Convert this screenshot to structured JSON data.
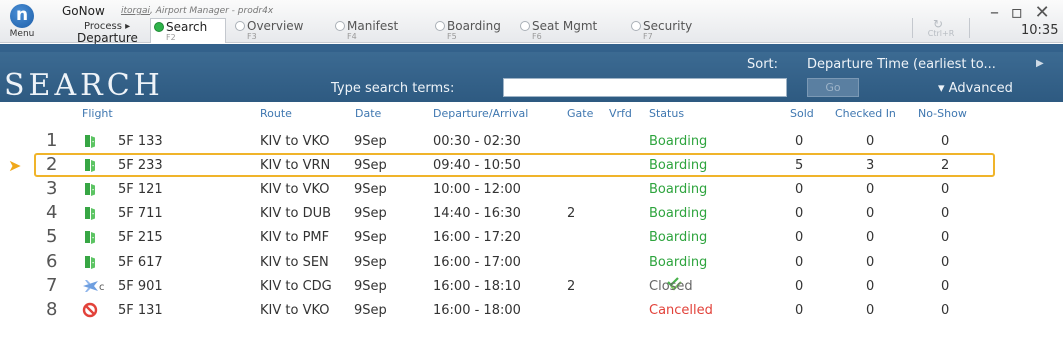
{
  "titlebar": {
    "menu_glyph": "n",
    "menu_label": "Menu",
    "app_name": "GoNow",
    "user": "itorgai",
    "role_env": ", Airport Manager - prodr4x",
    "process_label": "Process ▸",
    "departure_label": "Departure",
    "steps": [
      {
        "name": "Search",
        "key": "F2",
        "active": true
      },
      {
        "name": "Overview",
        "key": "F3",
        "active": false
      },
      {
        "name": "Manifest",
        "key": "F4",
        "active": false
      },
      {
        "name": "Boarding",
        "key": "F5",
        "active": false
      },
      {
        "name": "Seat Mgmt",
        "key": "F6",
        "active": false
      },
      {
        "name": "Security",
        "key": "F7",
        "active": false
      }
    ],
    "refresh_icon": "↻",
    "refresh_key": "Ctrl+R",
    "window_controls": "– ▫ ✕",
    "clock": "10:35"
  },
  "search": {
    "title": "SEARCH",
    "type_label": "Type search terms:",
    "input_value": "",
    "go_label": "Go",
    "sort_label": "Sort:",
    "sort_value": "Departure Time (earliest to...",
    "sort_arrow": "▶",
    "advanced_label": "▾ Advanced"
  },
  "columns": {
    "flight": "Flight",
    "route": "Route",
    "date": "Date",
    "dep_arr": "Departure/Arrival",
    "gate": "Gate",
    "vrfd": "Vrfd",
    "status": "Status",
    "sold": "Sold",
    "checked_in": "Checked In",
    "no_show": "No-Show"
  },
  "colors": {
    "boarding": "#2ea43e",
    "cancelled": "#e2423a",
    "selected_border": "#f0b42a",
    "header_band": "#33618b"
  },
  "selected_marker": "➤",
  "rows": [
    {
      "idx": "1",
      "icon": "open-door-icon",
      "flight": "5F 133",
      "route": "KIV to VKO",
      "date": "9Sep",
      "time": "00:30 - 02:30",
      "gate": "",
      "vrfd": false,
      "status": "Boarding",
      "status_type": "boarding",
      "sold": "0",
      "checked": "0",
      "noshow": "0",
      "selected": false
    },
    {
      "idx": "2",
      "icon": "open-door-icon",
      "flight": "5F 233",
      "route": "KIV to VRN",
      "date": "9Sep",
      "time": "09:40 - 10:50",
      "gate": "",
      "vrfd": false,
      "status": "Boarding",
      "status_type": "boarding",
      "sold": "5",
      "checked": "3",
      "noshow": "2",
      "selected": true
    },
    {
      "idx": "3",
      "icon": "open-door-icon",
      "flight": "5F 121",
      "route": "KIV to VKO",
      "date": "9Sep",
      "time": "10:00 - 12:00",
      "gate": "",
      "vrfd": false,
      "status": "Boarding",
      "status_type": "boarding",
      "sold": "0",
      "checked": "0",
      "noshow": "0",
      "selected": false
    },
    {
      "idx": "4",
      "icon": "open-door-icon",
      "flight": "5F 711",
      "route": "KIV to DUB",
      "date": "9Sep",
      "time": "14:40 - 16:30",
      "gate": "2",
      "vrfd": false,
      "status": "Boarding",
      "status_type": "boarding",
      "sold": "0",
      "checked": "0",
      "noshow": "0",
      "selected": false
    },
    {
      "idx": "5",
      "icon": "open-door-icon",
      "flight": "5F 215",
      "route": "KIV to PMF",
      "date": "9Sep",
      "time": "16:00 - 17:20",
      "gate": "",
      "vrfd": false,
      "status": "Boarding",
      "status_type": "boarding",
      "sold": "0",
      "checked": "0",
      "noshow": "0",
      "selected": false
    },
    {
      "idx": "6",
      "icon": "open-door-icon",
      "flight": "5F 617",
      "route": "KIV to SEN",
      "date": "9Sep",
      "time": "16:00 - 17:00",
      "gate": "",
      "vrfd": false,
      "status": "Boarding",
      "status_type": "boarding",
      "sold": "0",
      "checked": "0",
      "noshow": "0",
      "selected": false
    },
    {
      "idx": "7",
      "icon": "plane-closed-icon",
      "icon_sub": "c",
      "flight": "5F 901",
      "route": "KIV to CDG",
      "date": "9Sep",
      "time": "16:00 - 18:10",
      "gate": "2",
      "vrfd": true,
      "status": "Closed",
      "status_type": "closed",
      "sold": "0",
      "checked": "0",
      "noshow": "0",
      "selected": false
    },
    {
      "idx": "8",
      "icon": "cancelled-icon",
      "flight": "5F 131",
      "route": "KIV to VKO",
      "date": "9Sep",
      "time": "16:00 - 18:00",
      "gate": "",
      "vrfd": false,
      "status": "Cancelled",
      "status_type": "cancelled",
      "sold": "0",
      "checked": "0",
      "noshow": "0",
      "selected": false
    }
  ]
}
